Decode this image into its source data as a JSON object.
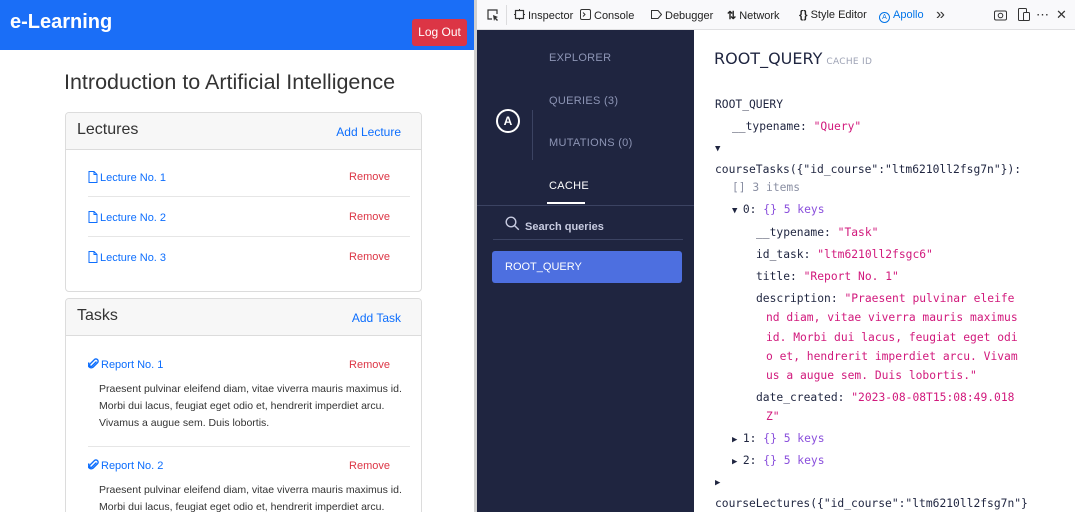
{
  "app": {
    "brand": "e-Learning",
    "logout_label": "Log Out",
    "course_title": "Introduction to Artificial Intelligence",
    "lectures": {
      "title": "Lectures",
      "add_label": "Add Lecture",
      "items": [
        {
          "label": "Lecture No. 1",
          "remove": "Remove"
        },
        {
          "label": "Lecture No. 2",
          "remove": "Remove"
        },
        {
          "label": "Lecture No. 3",
          "remove": "Remove"
        }
      ]
    },
    "tasks": {
      "title": "Tasks",
      "add_label": "Add Task",
      "items": [
        {
          "label": "Report No. 1",
          "remove": "Remove",
          "description": "Praesent pulvinar eleifend diam, vitae viverra mauris maximus id. Morbi dui lacus, feugiat eget odio et, hendrerit imperdiet arcu. Vivamus a augue sem. Duis lobortis."
        },
        {
          "label": "Report No. 2",
          "remove": "Remove",
          "description": "Praesent pulvinar eleifend diam, vitae viverra mauris maximus id. Morbi dui lacus, feugiat eget odio et, hendrerit imperdiet arcu. Vivamus a augue sem. Duis lobortis."
        }
      ]
    }
  },
  "devtools": {
    "tabs": [
      {
        "label": "Inspector",
        "icon": "inspector-icon"
      },
      {
        "label": "Console",
        "icon": "console-icon"
      },
      {
        "label": "Debugger",
        "icon": "debugger-icon"
      },
      {
        "label": "Network",
        "icon": "network-icon"
      },
      {
        "label": "Style Editor",
        "icon": "style-editor-icon"
      },
      {
        "label": "Apollo",
        "icon": "apollo-icon",
        "selected": true
      }
    ],
    "overflow_glyph": "»",
    "more_glyph": "⋯",
    "close_glyph": "✕",
    "picker_icon": "element-picker-icon",
    "screenshot_icon": "screenshot-icon",
    "responsive_icon": "responsive-icon"
  },
  "apollo": {
    "logo_letter": "A",
    "tabs": {
      "explorer": "EXPLORER",
      "queries": "QUERIES (3)",
      "mutations": "MUTATIONS (0)",
      "cache": "CACHE"
    },
    "search_placeholder": "Search queries",
    "selected_entry": "ROOT_QUERY",
    "heading": "ROOT_QUERY",
    "heading_sub": "CACHE ID",
    "tree": {
      "root": "ROOT_QUERY",
      "typename_key": "__typename",
      "typename_val": "\"Query\"",
      "course_tasks_key": "courseTasks({\"id_course\":\"ltm6210ll2fsg7n\"}):",
      "tasks_meta_bracket": "[]",
      "tasks_meta_count": "3 items",
      "item0_key": "0:",
      "item0_brace": "{}",
      "item0_count": "5 keys",
      "task_typename_key": "__typename:",
      "task_typename_val": "\"Task\"",
      "id_task_key": "id_task:",
      "id_task_val": "\"ltm6210ll2fsgc6\"",
      "title_key": "title:",
      "title_val": "\"Report No. 1\"",
      "description_key": "description:",
      "description_lines": [
        "\"Praesent pulvinar eleife",
        "nd diam, vitae viverra mauris maximus",
        "id. Morbi dui lacus, feugiat eget odi",
        "o et, hendrerit imperdiet arcu. Vivam",
        "us a augue sem. Duis lobortis.\""
      ],
      "date_key": "date_created:",
      "date_lines": [
        "\"2023-08-08T15:08:49.018",
        "Z\""
      ],
      "item1_key": "1:",
      "item2_key": "2:",
      "item_brace": "{}",
      "item_count": "5 keys",
      "course_lectures_key": "courseLectures({\"id_course\":\"ltm6210ll2fsg7n\"}"
    }
  },
  "colors": {
    "navbar": "#1a6ef7",
    "danger": "#dc3545",
    "link": "#0d6efd",
    "apollo_sidebar": "#1f2540",
    "apollo_selected": "#4d6fe0",
    "string_value": "#d1197c"
  }
}
